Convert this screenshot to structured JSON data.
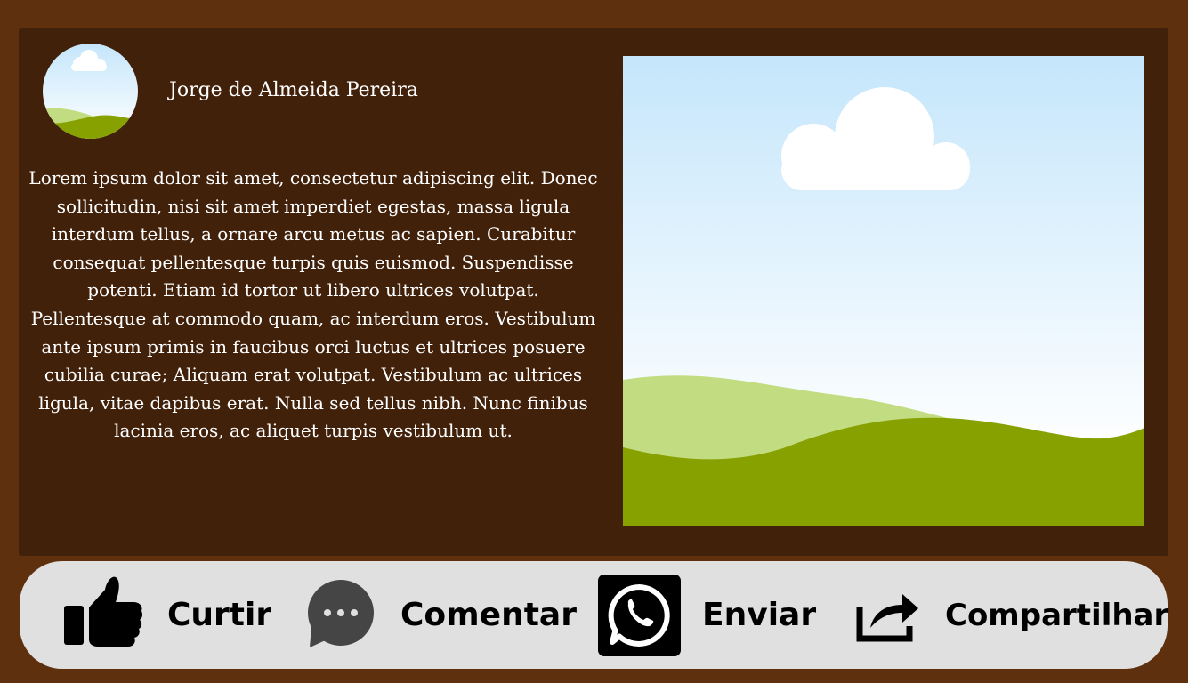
{
  "post": {
    "author_name": "Jorge de Almeida Pereira",
    "body": "Lorem ipsum dolor sit amet, consectetur adipiscing elit. Donec sollicitudin, nisi sit amet imperdiet egestas, massa ligula interdum tellus, a ornare arcu metus ac sapien. Curabitur consequat pellentesque turpis quis euismod. Suspendisse potenti. Etiam id tortor ut libero ultrices volutpat. Pellentesque at commodo quam, ac interdum eros. Vestibulum ante ipsum primis in faucibus orci luctus et ultrices posuere cubilia curae; Aliquam erat volutpat. Vestibulum ac ultrices ligula, vitae dapibus erat. Nulla sed tellus nibh. Nunc finibus lacinia eros, ac aliquet turpis vestibulum ut."
  },
  "actions": [
    {
      "label": "Curtir",
      "icon": "thumbs-up-icon"
    },
    {
      "label": "Comentar",
      "icon": "speech-bubble-icon"
    },
    {
      "label": "Enviar",
      "icon": "whatsapp-icon"
    },
    {
      "label": "Compartilhar",
      "icon": "share-arrow-icon"
    }
  ],
  "colors": {
    "page_background": "#5e300e",
    "card_background": "#42210b",
    "action_bar_background": "#e0e0e0",
    "sky_top": "#c5e6fb",
    "sky_bottom": "#ffffff",
    "hill_light": "#c2dc81",
    "hill_dark": "#87a100",
    "text": "#ffffff"
  }
}
